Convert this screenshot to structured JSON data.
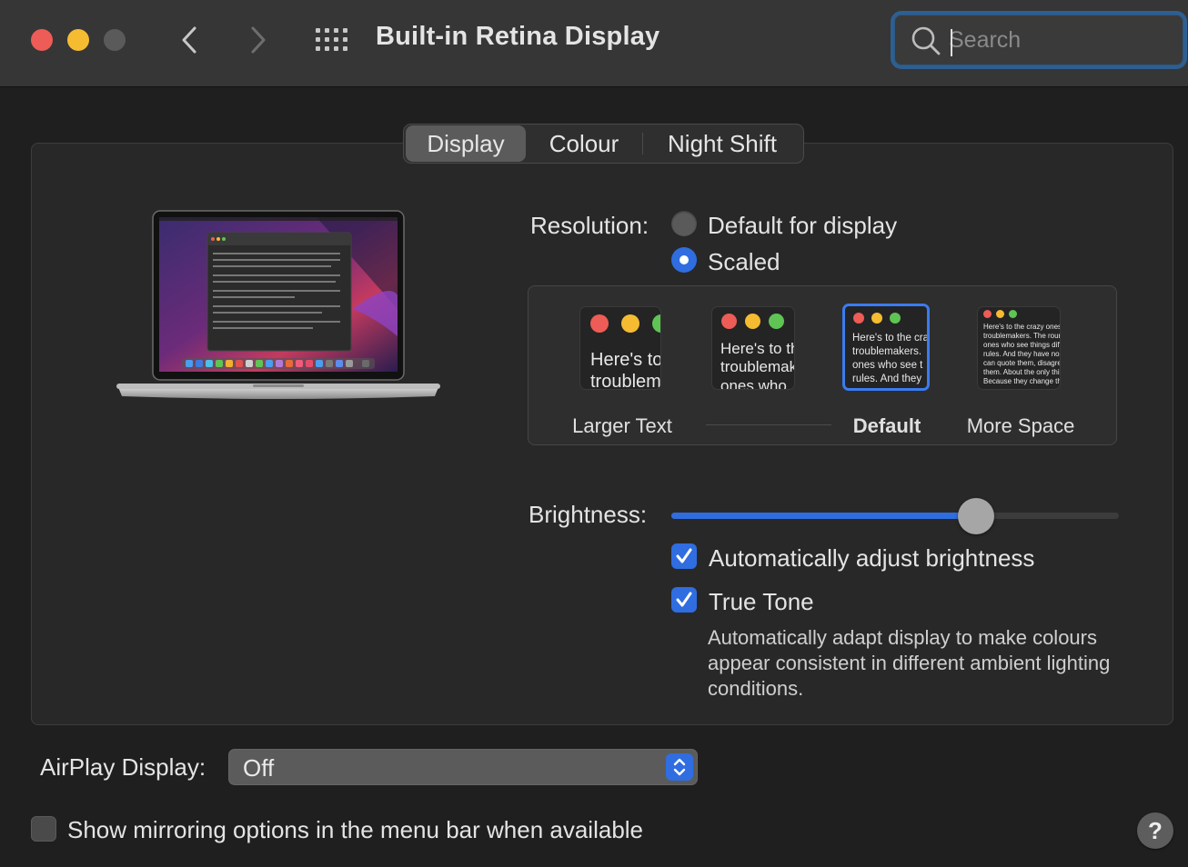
{
  "window": {
    "title": "Built-in Retina Display",
    "search_placeholder": "Search"
  },
  "tabs": [
    {
      "label": "Display",
      "selected": true
    },
    {
      "label": "Colour",
      "selected": false
    },
    {
      "label": "Night Shift",
      "selected": false
    }
  ],
  "resolution": {
    "label": "Resolution:",
    "options": [
      {
        "label": "Default for display",
        "selected": false
      },
      {
        "label": "Scaled",
        "selected": true
      }
    ],
    "scales": [
      {
        "label": "Larger Text",
        "preview": "Here's to the crazy\ntroublemakers"
      },
      {
        "label": "",
        "preview": "Here's to the\ntroublemakers.\nones who"
      },
      {
        "label": "Default",
        "preview": "Here's to the crazy\ntroublemakers.\nones who see t\nrules. And they",
        "selected": true
      },
      {
        "label": "More Space",
        "preview": "Here's to the crazy ones\ntroublemakers. The round\nones who see things differently.\nrules. And they have no\ncan quote them, disagree\nthem. About the only thing\nBecause they change things"
      }
    ]
  },
  "brightness": {
    "label": "Brightness:",
    "level": 0.68,
    "auto_adjust": {
      "label": "Automatically adjust brightness",
      "checked": true
    },
    "true_tone": {
      "label": "True Tone",
      "checked": true
    },
    "true_tone_description": "Automatically adapt display to make colours appear consistent in different ambient lighting conditions."
  },
  "airplay": {
    "label": "AirPlay Display:",
    "value": "Off"
  },
  "mirroring": {
    "label": "Show mirroring options in the menu bar when available",
    "checked": false
  },
  "help": {
    "label": "?"
  },
  "colors": {
    "accent": "#2f6de0",
    "close": "#ed5c56",
    "minimize": "#f5bc32",
    "zoom_disabled": "#5a5a5a"
  }
}
